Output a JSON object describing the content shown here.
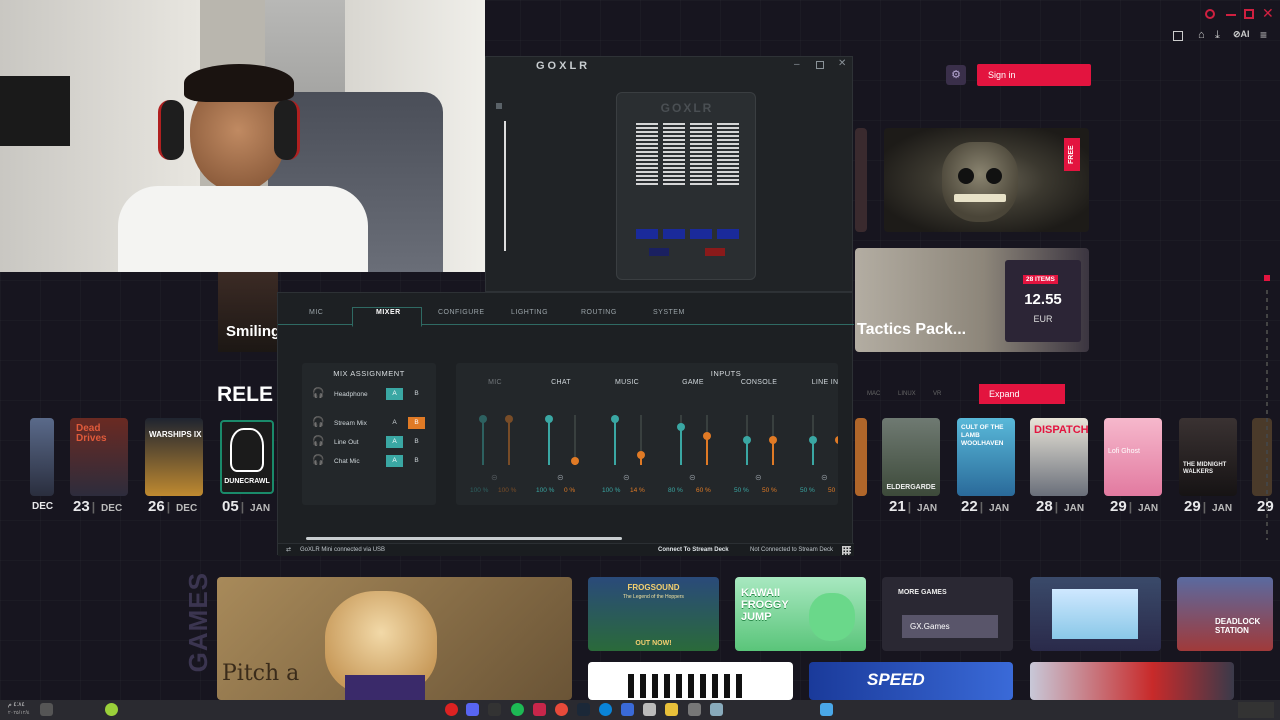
{
  "browser": {
    "sign_in_label": "Sign in",
    "expand_label": "Expand",
    "free_badge": "FREE",
    "bundle": {
      "items_badge": "28 ITEMS",
      "price": "12.55",
      "currency": "EUR",
      "title": "Tactics Pack..."
    },
    "section_partial_title": "RELE",
    "featured_partial": "Smiling",
    "games_vertical": "GAMES",
    "more_games_label": "MORE GAMES",
    "gx_games_button": "GX.Games",
    "filter_tabs": [
      "MAC",
      "LINUX",
      "VR"
    ],
    "left_releases": [
      {
        "day": "23",
        "month": "DEC",
        "title": "Dead Drives"
      },
      {
        "day": "26",
        "month": "DEC",
        "title": "WARSHIPS IX"
      },
      {
        "day": "05",
        "month": "JAN",
        "title": "DUNECRAWL"
      }
    ],
    "left_partial_month": "DEC",
    "right_releases": [
      {
        "day": "21",
        "month": "JAN",
        "title": "ELDERGARDE"
      },
      {
        "day": "22",
        "month": "JAN",
        "title": "CULT OF THE LAMB WOOLHAVEN"
      },
      {
        "day": "28",
        "month": "JAN",
        "title": "DISPATCH"
      },
      {
        "day": "29",
        "month": "JAN",
        "title": "Lofi Ghost"
      },
      {
        "day": "29",
        "month": "JAN",
        "title": "THE MIDNIGHT WALKERS"
      }
    ],
    "right_partial_day": "29",
    "games_row": [
      {
        "title": "FROGSOUND",
        "subtitle": "The Legend of the Hoppers",
        "caption": "OUT NOW!"
      },
      {
        "title": "KAWAII FROGGY JUMP"
      },
      {
        "title": "DEADLOCK STATION"
      },
      {
        "title": "SPEED"
      }
    ],
    "pitch_text": "Pitch a"
  },
  "goxlr": {
    "window_title": "GOXLR",
    "device_label": "GOXLR",
    "tabs": [
      "MIC",
      "MIXER",
      "CONFIGURE",
      "LIGHTING",
      "ROUTING",
      "SYSTEM"
    ],
    "active_tab": "MIXER",
    "mix_assignment_title": "MIX ASSIGNMENT",
    "inputs_title": "INPUTS",
    "mix_assignment": [
      {
        "name": "Headphone",
        "a": "A",
        "b": "B",
        "a_active": true,
        "b_active": false
      },
      {
        "name": "Stream Mix",
        "a": "A",
        "b": "B",
        "a_active": false,
        "b_active": true
      },
      {
        "name": "Line Out",
        "a": "A",
        "b": "B",
        "a_active": true,
        "b_active": false
      },
      {
        "name": "Chat Mic",
        "a": "A",
        "b": "B",
        "a_active": true,
        "b_active": false
      }
    ],
    "channels": [
      {
        "name": "MIC",
        "a_pct": "100 %",
        "b_pct": "100 %",
        "a_level": 1.0,
        "b_level": 1.0,
        "dimmed": true
      },
      {
        "name": "CHAT",
        "a_pct": "100 %",
        "b_pct": "0 %",
        "a_level": 1.0,
        "b_level": 0.0
      },
      {
        "name": "MUSIC",
        "a_pct": "100 %",
        "b_pct": "14 %",
        "a_level": 1.0,
        "b_level": 0.14
      },
      {
        "name": "GAME",
        "a_pct": "80 %",
        "b_pct": "60 %",
        "a_level": 0.8,
        "b_level": 0.6
      },
      {
        "name": "CONSOLE",
        "a_pct": "50 %",
        "b_pct": "50 %",
        "a_level": 0.5,
        "b_level": 0.5
      },
      {
        "name": "LINE IN",
        "a_pct": "50 %",
        "b_pct": "50",
        "a_level": 0.5,
        "b_level": 0.5
      }
    ],
    "status_connected": "GoXLR Mini connected via USB",
    "connect_stream_deck": "Connect To Stream Deck",
    "stream_deck_status": "Not Connected to Stream Deck",
    "colors": {
      "channel_a": "#3aa7a3",
      "channel_b": "#e07a25",
      "accent": "#e03050"
    }
  },
  "taskbar": {
    "left_text": "٤:٨٤ م",
    "left_date": "٢٠٢٥/١٢/٤"
  }
}
